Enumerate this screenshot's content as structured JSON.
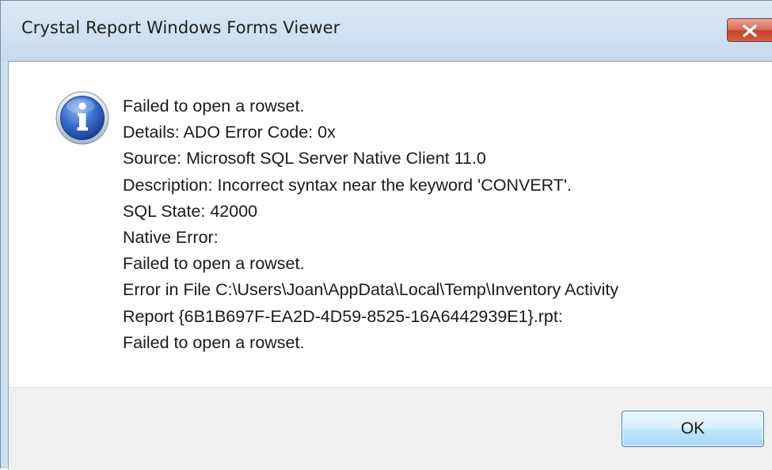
{
  "window": {
    "title": "Crystal Report Windows Forms Viewer"
  },
  "dialog": {
    "icon": "information-icon",
    "message_lines": [
      "Failed to open a rowset.",
      "Details: ADO Error Code: 0x",
      "Source: Microsoft SQL Server Native Client 11.0",
      "Description: Incorrect syntax near the keyword 'CONVERT'.",
      "SQL State: 42000",
      "Native Error:",
      "Failed to open a rowset.",
      "Error in File C:\\Users\\Joan\\AppData\\Local\\Temp\\Inventory Activity",
      "Report {6B1B697F-EA2D-4D59-8525-16A6442939E1}.rpt:",
      "Failed to open a rowset."
    ],
    "ok_label": "OK"
  },
  "colors": {
    "titlebar": "#d1e2f3",
    "close_button": "#c5442c",
    "button_bar": "#f0f0f0",
    "ok_button_border": "#3c7fb1"
  }
}
